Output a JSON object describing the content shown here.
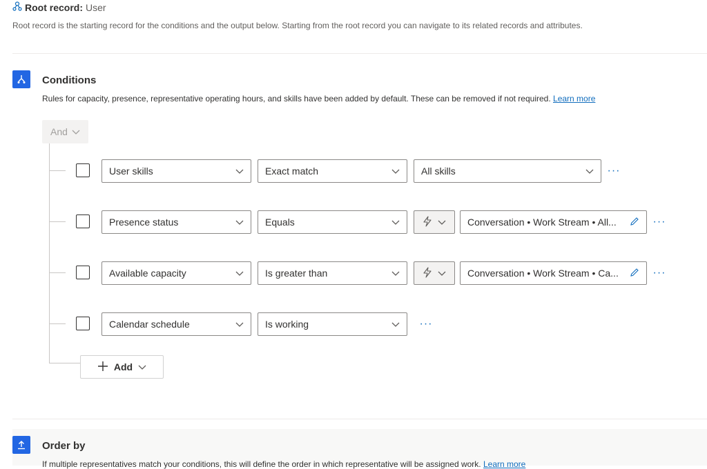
{
  "root": {
    "title_label": "Root record:",
    "title_value": "User",
    "description": "Root record is the starting record for the conditions and the output below. Starting from the root record you can navigate to its related records and attributes."
  },
  "conditions": {
    "title": "Conditions",
    "description": "Rules for capacity, presence, representative operating hours, and skills have been added by default. These can be removed if not required.",
    "learn_more": "Learn more",
    "group_operator": "And",
    "rows": [
      {
        "attribute": "User skills",
        "operator": "Exact match",
        "value": "All skills"
      },
      {
        "attribute": "Presence status",
        "operator": "Equals",
        "value": "Conversation • Work Stream • All..."
      },
      {
        "attribute": "Available capacity",
        "operator": "Is greater than",
        "value": "Conversation • Work Stream • Ca..."
      },
      {
        "attribute": "Calendar schedule",
        "operator": "Is working",
        "value": ""
      }
    ],
    "add_label": "Add"
  },
  "order_by": {
    "title": "Order by",
    "description": "If multiple representatives match your conditions, this will define the order in which representative will be assigned work.",
    "learn_more": "Learn more"
  },
  "colors": {
    "accent": "#2266e3",
    "link": "#0f6cbd"
  }
}
